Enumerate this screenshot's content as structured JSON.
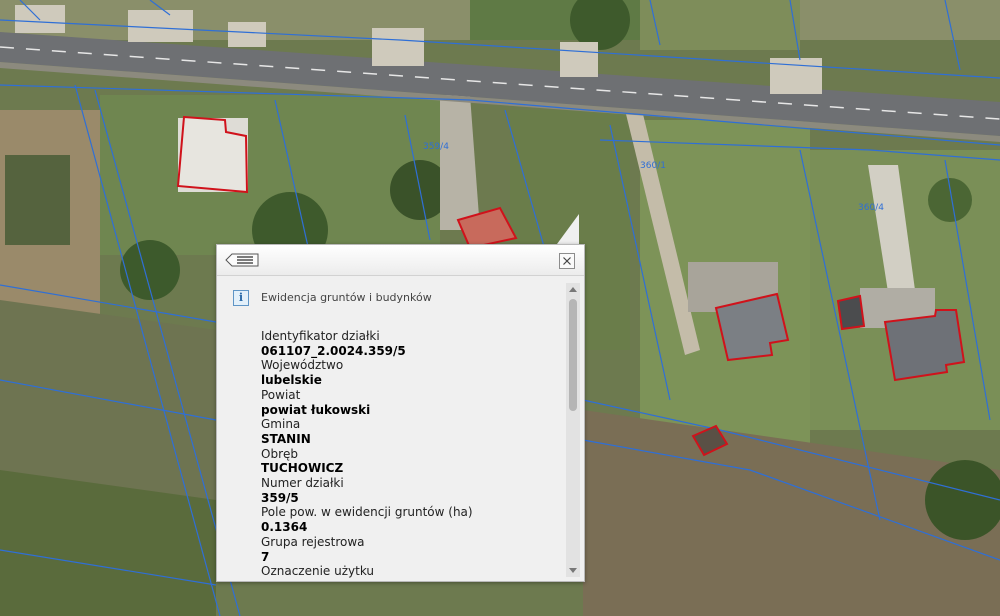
{
  "map": {
    "parcel_labels": [
      "359/4",
      "360/1",
      "360/4"
    ]
  },
  "popup": {
    "title": "Ewidencja gruntów i budynków",
    "icons": {
      "back": "list-back-icon",
      "close": "close-icon",
      "info": "info-icon"
    },
    "info_glyph": "i",
    "fields": [
      {
        "label": "Identyfikator działki",
        "value": "061107_2.0024.359/5"
      },
      {
        "label": "Województwo",
        "value": "lubelskie"
      },
      {
        "label": "Powiat",
        "value": "powiat łukowski"
      },
      {
        "label": "Gmina",
        "value": "STANIN"
      },
      {
        "label": "Obręb",
        "value": "TUCHOWICZ"
      },
      {
        "label": "Numer działki",
        "value": "359/5"
      },
      {
        "label": "Pole pow. w ewidencji gruntów (ha)",
        "value": "0.1364"
      },
      {
        "label": "Grupa rejestrowa",
        "value": "7"
      },
      {
        "label": "Oznaczenie użytku",
        "value": ""
      }
    ]
  },
  "colors": {
    "parcel_boundary": "#2f6fd6",
    "building_outline": "#d0121b",
    "road": "#6e7073",
    "popup_bg": "#f0f0f0"
  }
}
